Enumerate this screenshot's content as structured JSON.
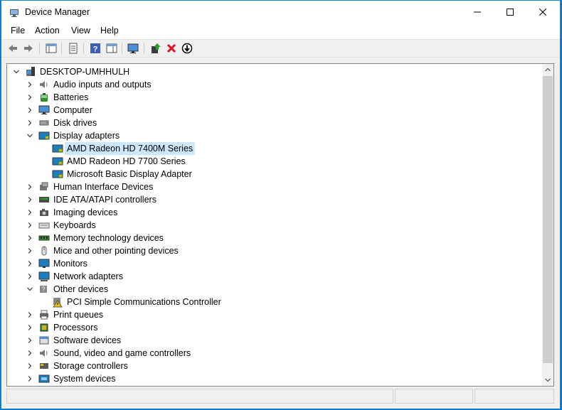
{
  "window": {
    "title": "Device Manager"
  },
  "menu": [
    "File",
    "Action",
    "View",
    "Help"
  ],
  "tree": {
    "root": "DESKTOP-UMHHULH",
    "items": [
      {
        "label": "Audio inputs and outputs",
        "icon": "speaker-icon",
        "expanded": false
      },
      {
        "label": "Batteries",
        "icon": "battery-icon",
        "expanded": false
      },
      {
        "label": "Computer",
        "icon": "computer-icon",
        "expanded": false
      },
      {
        "label": "Disk drives",
        "icon": "disk-icon",
        "expanded": false
      },
      {
        "label": "Display adapters",
        "icon": "display-adapter-icon",
        "expanded": true,
        "children": [
          {
            "label": "AMD Radeon HD 7400M Series",
            "icon": "display-adapter-icon",
            "selected": true
          },
          {
            "label": "AMD Radeon HD 7700 Series",
            "icon": "display-adapter-icon"
          },
          {
            "label": "Microsoft Basic Display Adapter",
            "icon": "display-adapter-icon"
          }
        ]
      },
      {
        "label": "Human Interface Devices",
        "icon": "hid-icon",
        "expanded": false
      },
      {
        "label": "IDE ATA/ATAPI controllers",
        "icon": "ide-controller-icon",
        "expanded": false
      },
      {
        "label": "Imaging devices",
        "icon": "camera-icon",
        "expanded": false
      },
      {
        "label": "Keyboards",
        "icon": "keyboard-icon",
        "expanded": false
      },
      {
        "label": "Memory technology devices",
        "icon": "memory-icon",
        "expanded": false
      },
      {
        "label": "Mice and other pointing devices",
        "icon": "mouse-icon",
        "expanded": false
      },
      {
        "label": "Monitors",
        "icon": "monitor-icon",
        "expanded": false
      },
      {
        "label": "Network adapters",
        "icon": "network-icon",
        "expanded": false
      },
      {
        "label": "Other devices",
        "icon": "unknown-device-icon",
        "expanded": true,
        "children": [
          {
            "label": "PCI Simple Communications Controller",
            "icon": "warning-device-icon"
          }
        ]
      },
      {
        "label": "Print queues",
        "icon": "printer-icon",
        "expanded": false
      },
      {
        "label": "Processors",
        "icon": "processor-icon",
        "expanded": false
      },
      {
        "label": "Software devices",
        "icon": "software-device-icon",
        "expanded": false
      },
      {
        "label": "Sound, video and game controllers",
        "icon": "speaker-icon",
        "expanded": false
      },
      {
        "label": "Storage controllers",
        "icon": "storage-icon",
        "expanded": false
      },
      {
        "label": "System devices",
        "icon": "system-icon",
        "expanded": false
      }
    ]
  },
  "colors": {
    "accent": "#0078d7",
    "selection": "#cce8ff",
    "scrollbar": "#cdcdcd"
  }
}
